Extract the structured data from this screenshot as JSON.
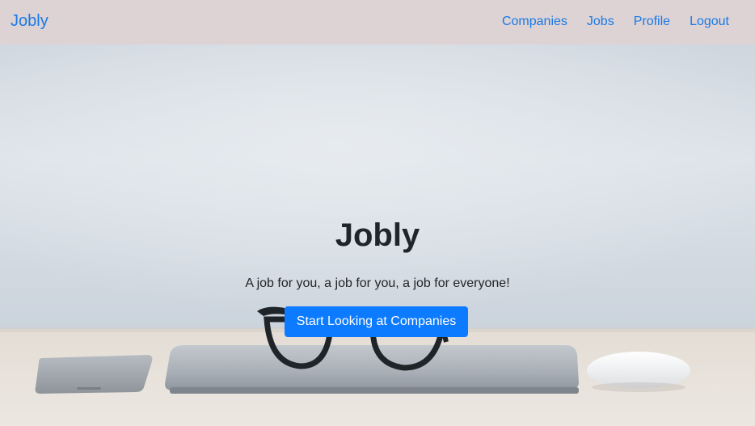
{
  "navbar": {
    "brand": "Jobly",
    "links": [
      {
        "label": "Companies"
      },
      {
        "label": "Jobs"
      },
      {
        "label": "Profile"
      },
      {
        "label": "Logout"
      }
    ],
    "background_color": "#ddd2d4",
    "link_color": "#1a7ae6"
  },
  "hero": {
    "title": "Jobly",
    "subtitle": "A job for you, a job for you, a job for everyone!",
    "cta_label": "Start Looking at Companies",
    "cta_color": "#0d7bff",
    "background_image": "desk-with-laptop-glasses-phone-mouse"
  }
}
